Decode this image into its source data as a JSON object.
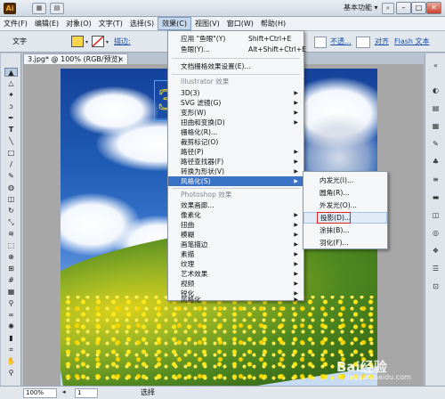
{
  "titlebar": {
    "logo": "Ai",
    "workspace": "基本功能",
    "workspace_arrow": "▾",
    "search_icon": "search-icon",
    "minimize": "–",
    "maximize": "□",
    "close": "✕"
  },
  "menubar": {
    "items": [
      "文件(F)",
      "编辑(E)",
      "对象(O)",
      "文字(T)",
      "选择(S)",
      "效果(C)",
      "视图(V)",
      "窗口(W)",
      "帮助(H)"
    ]
  },
  "controlbar": {
    "label": "文字",
    "stroke_label": "描边:",
    "opacity_label": "不透...",
    "align_label": "对齐",
    "flash_label": "Flash 文本",
    "fill_color": "#f6d54a",
    "stroke_color": "#ffffff"
  },
  "document": {
    "tab_label": "3.jpg* @ 100% (RGB/预览)",
    "tab_close": "×"
  },
  "effect_menu": {
    "apply_last": "应用 \"鱼眼\"(Y)",
    "apply_last_shortcut": "Shift+Ctrl+E",
    "last_effect": "鱼眼(Y)...",
    "last_effect_shortcut": "Alt+Shift+Ctrl+E",
    "raster_settings": "文档栅格效果设置(E)...",
    "illustrator_header": "Illustrator 效果",
    "illustrator_items": [
      "3D(3)",
      "SVG 滤镜(G)",
      "变形(W)",
      "扭曲和变换(D)",
      "栅格化(R)...",
      "裁剪标记(O)",
      "路径(P)",
      "路径查找器(F)",
      "转换为形状(V)",
      "风格化(S)"
    ],
    "photoshop_header": "Photoshop 效果",
    "photoshop_items": [
      "效果画廊...",
      "像素化",
      "扭曲",
      "模糊",
      "画笔描边",
      "素描",
      "纹理",
      "艺术效果",
      "视频",
      "锐化",
      "风格化"
    ]
  },
  "stylize_submenu": {
    "items": [
      "内发光(I)...",
      "圆角(R)...",
      "外发光(O)...",
      "投影(D)...",
      "涂抹(B)...",
      "羽化(F)..."
    ]
  },
  "statusbar": {
    "zoom": "100%",
    "page": "1",
    "tool_status": "选择"
  },
  "watermark": {
    "brand": "Bai经验",
    "url": "jingyan.baidu.com"
  }
}
